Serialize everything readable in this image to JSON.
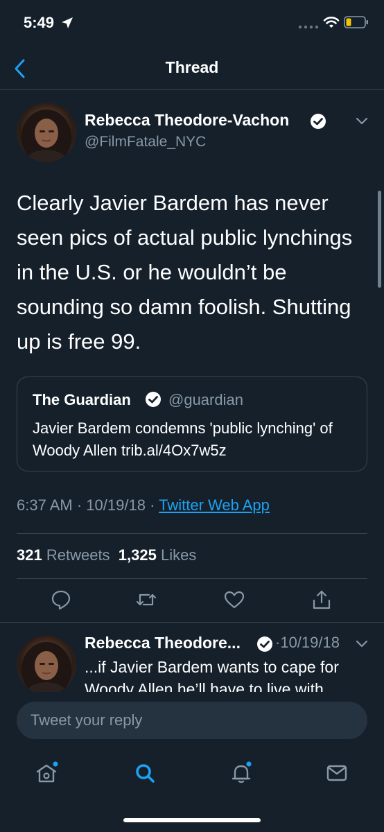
{
  "status_bar": {
    "time": "5:49",
    "icons": [
      "location-arrow-icon",
      "signal-icon",
      "wifi-icon",
      "battery-icon"
    ]
  },
  "nav": {
    "title": "Thread",
    "back_icon": "chevron-left-icon"
  },
  "tweet": {
    "author_name": "Rebecca Theodore-Vachon",
    "handle": "@FilmFatale_NYC",
    "verified": true,
    "text": "Clearly Javier Bardem has never seen pics of actual public lynchings in the U.S. or he wouldn’t be sounding so damn foolish. Shutting up is free 99.",
    "quote": {
      "author": "The Guardian",
      "handle": "@guardian",
      "verified": true,
      "text": "Javier Bardem condemns 'public lynching' of Woody Allen trib.al/4Ox7w5z"
    },
    "time": "6:37 AM",
    "date": "10/19/18",
    "separator": "·",
    "source": "Twitter Web App",
    "retweets_count": "321",
    "retweets_label": "Retweets",
    "likes_count": "1,325",
    "likes_label": "Likes"
  },
  "reply_tweet": {
    "author_name": "Rebecca Theodore...",
    "separator": "·",
    "date": "10/19/18",
    "verified": true,
    "text": "...if Javier Bardem wants to cape for Woody Allen he’ll have to live with"
  },
  "reply_box": {
    "placeholder": "Tweet your reply"
  },
  "tab_bar": {
    "items": [
      "home-icon",
      "search-icon",
      "notifications-icon",
      "messages-icon"
    ],
    "active": "search-icon"
  },
  "colors": {
    "background": "#15202b",
    "accent": "#1da1f2",
    "secondary_text": "#8899a6",
    "border": "#38444d"
  }
}
